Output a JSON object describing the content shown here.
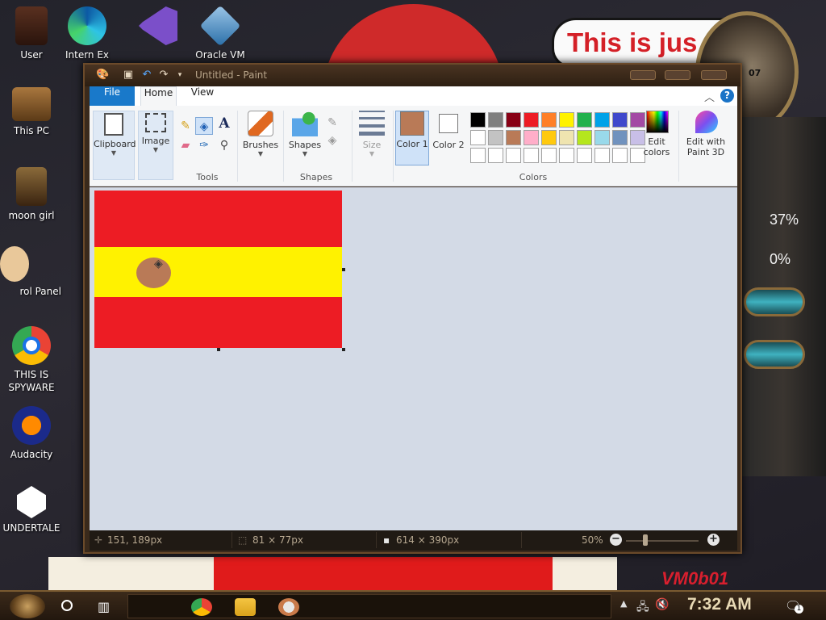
{
  "desktop": {
    "icons": [
      {
        "label": "User"
      },
      {
        "label": "Intern Ex"
      },
      {
        "label": "Oracle VM"
      },
      {
        "label": "This PC"
      },
      {
        "label": "moon girl"
      },
      {
        "label": "rol Panel"
      },
      {
        "label": "THIS IS SPYWARE"
      },
      {
        "label": "Audacity"
      },
      {
        "label": "UNDERTALE"
      }
    ],
    "wallpaper": {
      "speech_text": "This is jus",
      "clock_numeral": "07",
      "gauge_1": "37%",
      "gauge_2": "0%",
      "signature": "VM0b01"
    }
  },
  "paint": {
    "title": "Untitled - Paint",
    "tabs": {
      "file": "File",
      "home": "Home",
      "view": "View"
    },
    "ribbon": {
      "clipboard": "Clipboard",
      "image": "Image",
      "tools": "Tools",
      "brushes": "Brushes",
      "shapes_button": "Shapes",
      "shapes_group": "Shapes",
      "size": "Size",
      "color1": "Color 1",
      "color2": "Color 2",
      "colors": "Colors",
      "edit_colors": "Edit colors",
      "edit_paint3d": "Edit with Paint 3D"
    },
    "palette": {
      "row1": [
        "#000000",
        "#7f7f7f",
        "#880015",
        "#ed1c24",
        "#ff7f27",
        "#fff200",
        "#22b14c",
        "#00a2e8",
        "#3f48cc",
        "#a349a4"
      ],
      "row2": [
        "#ffffff",
        "#c3c3c3",
        "#b97a57",
        "#ffaec9",
        "#ffc90e",
        "#efe4b0",
        "#b5e61d",
        "#99d9ea",
        "#7092be",
        "#c8bfe7"
      ],
      "row3": [
        "#ffffff",
        "#ffffff",
        "#ffffff",
        "#ffffff",
        "#ffffff",
        "#ffffff",
        "#ffffff",
        "#ffffff",
        "#ffffff",
        "#ffffff"
      ],
      "color1": "#b97a57",
      "color2": "#ffffff"
    },
    "canvas": {
      "flag_red": "#ed1c24",
      "flag_yellow": "#fff200",
      "dot_color": "#b97a57"
    },
    "status": {
      "cursor_pos": "151, 189px",
      "selection_size": "81 × 77px",
      "image_size": "614 × 390px",
      "zoom": "50%"
    }
  },
  "taskbar": {
    "time": "7:32 AM",
    "notification_count": "1"
  }
}
